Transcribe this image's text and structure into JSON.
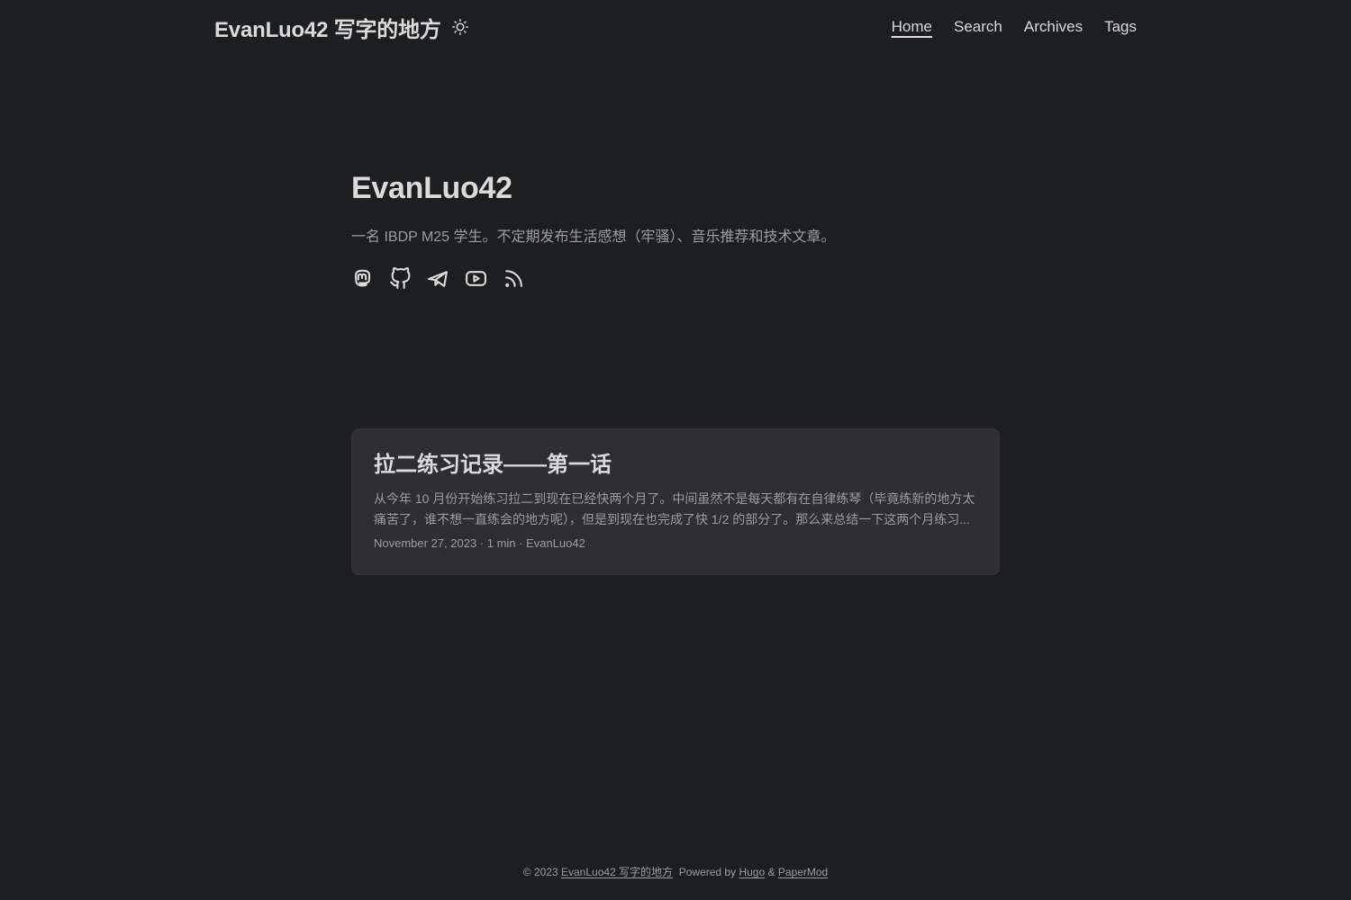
{
  "header": {
    "logo": "EvanLuo42 写字的地方",
    "theme_toggle_icon": "sun-icon",
    "menu": [
      {
        "label": "Home",
        "active": true
      },
      {
        "label": "Search",
        "active": false
      },
      {
        "label": "Archives",
        "active": false
      },
      {
        "label": "Tags",
        "active": false
      }
    ]
  },
  "home": {
    "title": "EvanLuo42",
    "description": "一名 IBDP M25 学生。不定期发布生活感想（牢骚）、音乐推荐和技术文章。",
    "social_icons": [
      "mastodon-icon",
      "github-icon",
      "telegram-icon",
      "youtube-icon",
      "rss-icon"
    ]
  },
  "posts": [
    {
      "title": "拉二练习记录——第一话",
      "summary": "从今年 10 月份开始练习拉二到现在已经快两个月了。中间虽然不是每天都有在自律练琴（毕竟练新的地方太痛苦了，谁不想一直练会的地方呢），但是到现在也完成了快 1/2 的部分了。那么来总结一下这两个月练习...",
      "meta": "November 27, 2023 · 1 min · EvanLuo42"
    }
  ],
  "footer": {
    "copyright": "© 2023",
    "site_link": "EvanLuo42 写字的地方",
    "powered_by": "Powered by",
    "hugo_link": "Hugo",
    "amp": "&",
    "theme_link": "PaperMod"
  },
  "colors": {
    "background": "#1d1e20",
    "entry": "#2e2e33",
    "primary": "#dadadb",
    "secondary": "#9b9c9d"
  }
}
